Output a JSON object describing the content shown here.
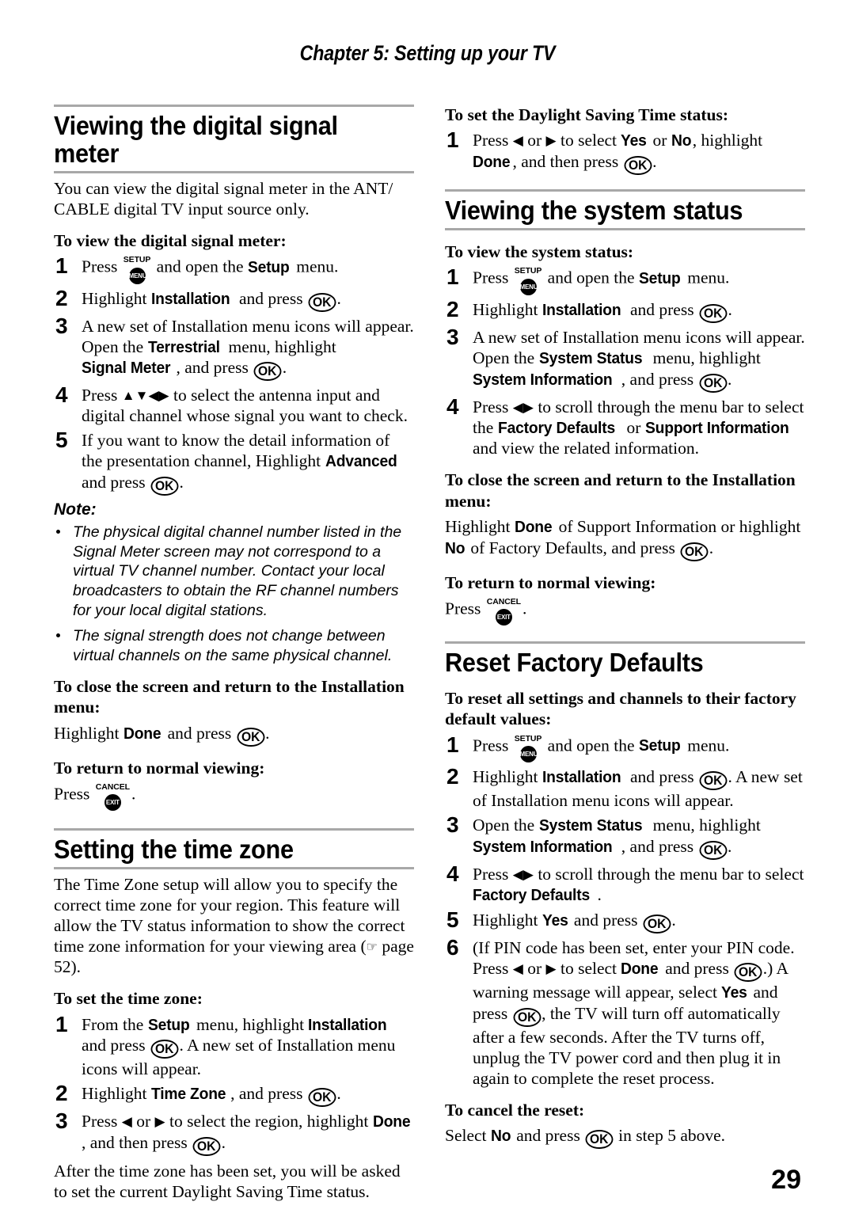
{
  "page": {
    "chapter_header": "Chapter 5: Setting up your TV",
    "page_number": "29",
    "rule_color": "#a8a8a8"
  },
  "icons": {
    "ok": "OK",
    "setup_cap": "SETUP",
    "setup_disc": "MENU",
    "cancel_cap": "CANCEL",
    "cancel_disc": "EXIT",
    "arrow_up": "▲",
    "arrow_down": "▼",
    "arrow_left": "◀",
    "arrow_right": "▶",
    "hand": "☞"
  },
  "left_column": {
    "section1": {
      "heading": "Viewing the digital signal meter",
      "intro": "You can view the digital signal meter in the ANT/ CABLE digital TV input source only.",
      "sub1": "To view the digital signal meter:",
      "steps": [
        {
          "num": "1",
          "pre": "Press ",
          "mid": " and open the ",
          "bold1": "Setup",
          "post": " menu."
        },
        {
          "num": "2",
          "pre": "Highlight ",
          "bold1": "Installation",
          "mid": " and press ",
          "post": "."
        },
        {
          "num": "3",
          "pre": "A new set of Installation menu icons will appear. Open the ",
          "bold1": "Terrestrial",
          "mid": " menu, highlight ",
          "bold2": "Signal Meter",
          "mid2": ", and press ",
          "post": "."
        },
        {
          "num": "4",
          "pre": "Press ",
          "mid": " to select the antenna input and digital channel whose signal you want to check."
        },
        {
          "num": "5",
          "pre": "If you want to know the detail information of the presentation channel, Highlight ",
          "bold1": "Advanced",
          "mid": " and press ",
          "post": "."
        }
      ],
      "note": {
        "title": "Note:",
        "bullets": [
          "The physical digital channel number listed in the Signal Meter screen may not correspond to a virtual TV channel number. Contact your local broadcasters to obtain the RF channel numbers for your local digital stations.",
          "The signal strength does not change between virtual channels on the same physical channel."
        ]
      },
      "sub2": "To close the screen and return to the Installation menu:",
      "close_pre": "Highlight ",
      "close_bold": "Done",
      "close_mid": " and press ",
      "close_post": ".",
      "sub3": "To return to normal viewing:",
      "return_pre": "Press ",
      "return_post": "."
    },
    "section2": {
      "heading": "Setting the time zone",
      "intro_a": "The Time Zone setup will allow you to specify the correct time zone for your region. This feature will allow the TV status information to show the correct time zone information for your viewing area (",
      "intro_b": " page 52).",
      "sub1": "To set the time zone:",
      "steps": [
        {
          "num": "1",
          "pre": "From the ",
          "bold1": "Setup",
          "mid": " menu, highlight ",
          "bold2": "Installation",
          "mid2": " and press ",
          "post": ". A new set of Installation menu icons will appear."
        },
        {
          "num": "2",
          "pre": "Highlight ",
          "bold1": "Time Zone",
          "mid": ", and press ",
          "post": "."
        },
        {
          "num": "3",
          "pre": "Press ",
          "mid": " or ",
          "mid2": " to select the region, highlight ",
          "bold1": "Done",
          "mid3": ", and then press ",
          "post": "."
        }
      ],
      "outro": "After the time zone has been set, you will be asked to set the current Daylight Saving Time status."
    }
  },
  "right_column": {
    "dst": {
      "sub1": "To set the Daylight Saving Time status:",
      "step": {
        "num": "1",
        "pre": "Press ",
        "mid": " or ",
        "mid2": " to select ",
        "bold1": "Yes",
        "mid3": " or ",
        "bold2": "No",
        "mid4": ", highlight ",
        "bold3": "Done",
        "mid5": ", and then press ",
        "post": "."
      }
    },
    "section1": {
      "heading": "Viewing the system status",
      "sub1": "To view the system status:",
      "steps": [
        {
          "num": "1",
          "pre": "Press ",
          "mid": " and open the ",
          "bold1": "Setup",
          "post": " menu."
        },
        {
          "num": "2",
          "pre": "Highlight ",
          "bold1": "Installation",
          "mid": " and press ",
          "post": "."
        },
        {
          "num": "3",
          "pre": "A new set of Installation menu icons will appear. Open the ",
          "bold1": "System Status",
          "mid": " menu, highlight ",
          "bold2": "System Information",
          "mid2": ", and press ",
          "post": "."
        },
        {
          "num": "4",
          "pre": "Press ",
          "mid": " to scroll through the menu bar to select the ",
          "bold1": "Factory Defaults",
          "mid2": " or ",
          "bold2": "Support Information",
          "post": " and view the related information."
        }
      ],
      "sub2": "To close the screen and return to the Installation menu:",
      "close_pre": "Highlight ",
      "close_bold1": "Done",
      "close_mid": " of Support Information or highlight ",
      "close_bold2": "No",
      "close_mid2": " of Factory Defaults, and press ",
      "close_post": ".",
      "sub3": "To return to normal viewing:",
      "return_pre": "Press ",
      "return_post": "."
    },
    "section2": {
      "heading": "Reset Factory Defaults",
      "sub1": "To reset all settings and channels to their factory default values:",
      "steps": [
        {
          "num": "1",
          "pre": "Press ",
          "mid": " and open the ",
          "bold1": "Setup",
          "post": " menu."
        },
        {
          "num": "2",
          "pre": "Highlight ",
          "bold1": "Installation",
          "mid": " and press ",
          "post": ". A new set of Installation menu icons will appear."
        },
        {
          "num": "3",
          "pre": "Open the ",
          "bold1": "System Status",
          "mid": " menu, highlight ",
          "bold2": "System Information",
          "mid2": ", and press ",
          "post": "."
        },
        {
          "num": "4",
          "pre": "Press ",
          "mid": " to scroll through the menu bar to select ",
          "bold1": "Factory Defaults",
          "post": "."
        },
        {
          "num": "5",
          "pre": "Highlight ",
          "bold1": "Yes",
          "mid": " and press ",
          "post": "."
        },
        {
          "num": "6",
          "pre": "(If PIN code has been set, enter your PIN code. Press ",
          "mid": " or ",
          "mid2": " to select ",
          "bold1": "Done",
          "mid3": " and press ",
          "mid4": ".) A warning message will appear, select ",
          "bold2": "Yes",
          "mid5": " and press ",
          "mid6": ", the TV will turn off automatically after a few seconds. After the TV turns off, unplug the TV power cord and then plug it in again to complete the reset process."
        }
      ],
      "sub2": "To cancel the reset:",
      "cancel_pre": "Select ",
      "cancel_bold": "No",
      "cancel_mid": " and press ",
      "cancel_post": " in step 5 above."
    }
  }
}
